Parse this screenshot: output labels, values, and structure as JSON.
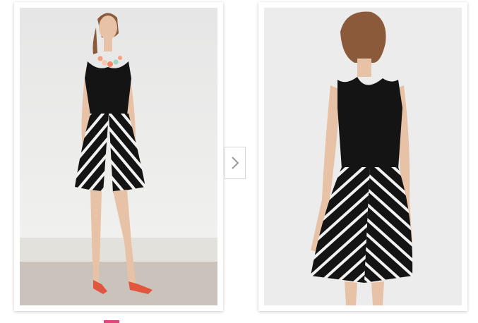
{
  "gallery": {
    "photos": [
      {
        "icon": "model-front-view-photo"
      },
      {
        "icon": "model-back-view-photo"
      }
    ],
    "next_arrow": {
      "icon": "chevron-right-icon"
    },
    "pager": {
      "active_index": 1,
      "color": "#e0457b"
    }
  },
  "colors": {
    "backdrop": "#ececec",
    "floor": "#c9c3bb",
    "dress_black": "#141414",
    "stripe_white": "#f2f2f2",
    "skin": "#e8c2a6",
    "hair": "#8a5a3a",
    "sandal": "#e2553f",
    "accent": "#e0457b"
  }
}
